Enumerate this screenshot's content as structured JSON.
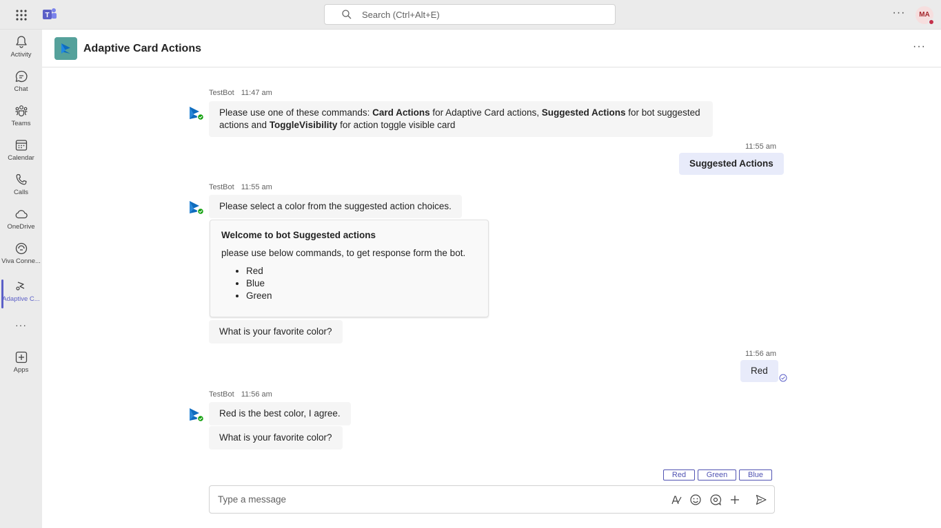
{
  "topbar": {
    "search_placeholder": "Search (Ctrl+Alt+E)",
    "more_label": "···",
    "avatar_initials": "MA",
    "colors": {
      "accent": "#5b5fc7",
      "presence": "#c4314b"
    }
  },
  "rail": {
    "items": [
      {
        "label": "Activity",
        "icon": "bell-icon"
      },
      {
        "label": "Chat",
        "icon": "chat-icon"
      },
      {
        "label": "Teams",
        "icon": "teams-icon"
      },
      {
        "label": "Calendar",
        "icon": "calendar-icon"
      },
      {
        "label": "Calls",
        "icon": "phone-icon"
      },
      {
        "label": "OneDrive",
        "icon": "cloud-icon"
      },
      {
        "label": "Viva Conne...",
        "icon": "viva-icon"
      },
      {
        "label": "Adaptive C...",
        "icon": "adaptive-card-icon"
      },
      {
        "label": "···",
        "icon": "more-icon"
      },
      {
        "label": "Apps",
        "icon": "add-apps-icon"
      }
    ]
  },
  "header": {
    "title": "Adaptive Card Actions",
    "more_label": "···"
  },
  "messages": {
    "m1": {
      "sender": "TestBot",
      "time": "11:47 am",
      "t1": "Please use one of these commands: ",
      "b1": "Card Actions",
      "t2": " for Adaptive Card actions, ",
      "b2": "Suggested Actions",
      "t3": " for bot suggested actions and ",
      "b3": "ToggleVisibility",
      "t4": " for action toggle visible card"
    },
    "u1": {
      "time": "11:55 am",
      "text": "Suggested Actions"
    },
    "m2": {
      "sender": "TestBot",
      "time": "11:55 am",
      "text": "Please select a color from the suggested action choices.",
      "card": {
        "title": "Welcome to bot Suggested actions",
        "body": "please use below commands, to get response form the bot.",
        "items": [
          "Red",
          "Blue",
          "Green"
        ]
      },
      "question": "What is your favorite color?"
    },
    "u2": {
      "time": "11:56 am",
      "text": "Red"
    },
    "m3": {
      "sender": "TestBot",
      "time": "11:56 am",
      "text": "Red is the best color, I agree.",
      "question": "What is your favorite color?"
    }
  },
  "suggested_actions": [
    "Red",
    "Green",
    "Blue"
  ],
  "compose": {
    "placeholder": "Type a message"
  }
}
